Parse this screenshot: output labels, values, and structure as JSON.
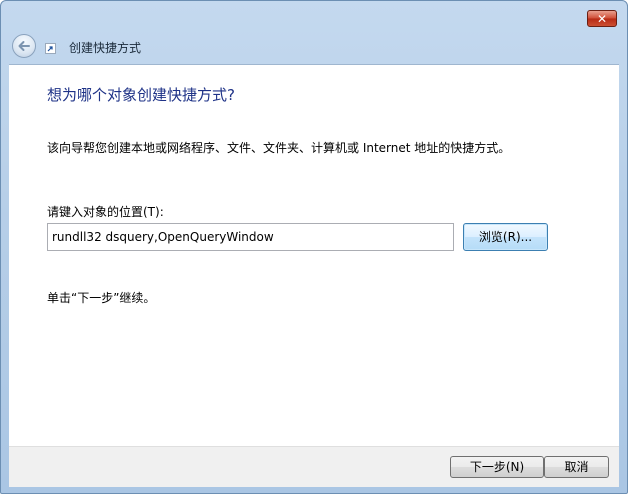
{
  "window": {
    "title": "创建快捷方式",
    "close_label": "✕"
  },
  "content": {
    "heading": "想为哪个对象创建快捷方式?",
    "description": "该向导帮您创建本地或网络程序、文件、文件夹、计算机或 Internet 地址的快捷方式。",
    "field_label": "请键入对象的位置(T):",
    "location_value": "rundll32 dsquery,OpenQueryWindow",
    "browse_label": "浏览(R)...",
    "hint": "单击“下一步”继续。"
  },
  "footer": {
    "next_label": "下一步(N)",
    "cancel_label": "取消"
  },
  "colors": {
    "heading": "#1e3287",
    "titlebar": "#b7cfe8",
    "close_button": "#c73a22"
  },
  "icons": {
    "back": "back-arrow-icon",
    "app": "shortcut-icon",
    "close": "close-icon"
  }
}
